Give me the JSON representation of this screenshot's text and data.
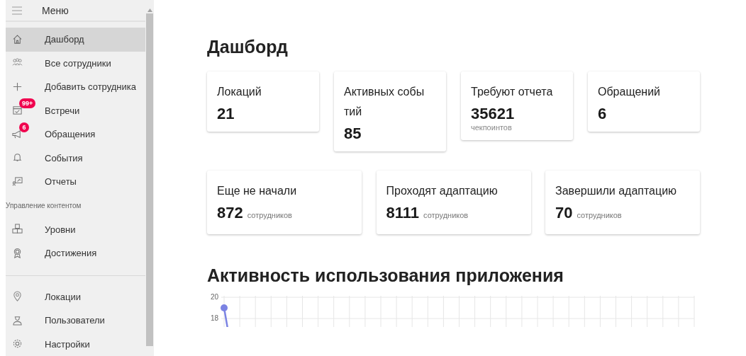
{
  "sidebar": {
    "header": {
      "title": "Меню"
    },
    "items": [
      {
        "kind": "link",
        "label": "Дашборд",
        "selected": true
      },
      {
        "kind": "link",
        "label": "Все сотрудники",
        "selected": false
      },
      {
        "kind": "link",
        "label": "Добавить сотрудника",
        "selected": false
      },
      {
        "kind": "link",
        "label": "Встречи",
        "selected": false,
        "badge": "99+"
      },
      {
        "kind": "link",
        "label": "Обращения",
        "selected": false,
        "badge": "6"
      },
      {
        "kind": "link",
        "label": "События",
        "selected": false
      },
      {
        "kind": "link",
        "label": "Отчеты",
        "selected": false
      },
      {
        "kind": "section",
        "label": "Управление контентом"
      },
      {
        "kind": "link",
        "label": "Уровни",
        "selected": false
      },
      {
        "kind": "link",
        "label": "Достижения",
        "selected": false
      },
      {
        "kind": "divider"
      },
      {
        "kind": "link",
        "label": "Локации",
        "selected": false
      },
      {
        "kind": "link",
        "label": "Пользователи",
        "selected": false
      },
      {
        "kind": "link",
        "label": "Настройки",
        "selected": false
      }
    ]
  },
  "main": {
    "title": "Дашборд",
    "stat_rows": [
      [
        {
          "label": "Локаций",
          "value": "21"
        },
        {
          "label": "Активных собы тий",
          "value": "85"
        },
        {
          "label": "Требуют отчета",
          "value": "35621",
          "caption": "чекпоинтов"
        },
        {
          "label": "Обращений",
          "value": "6"
        }
      ],
      [
        {
          "label": "Еще не начали",
          "value": "872",
          "unit": "сотрудников"
        },
        {
          "label": "Проходят адаптацию",
          "value": "8111",
          "unit": "сотрудников"
        },
        {
          "label": "Завершили адаптацию",
          "value": "70",
          "unit": "сотрудников"
        }
      ]
    ],
    "chart_title": "Активность использования приложения",
    "chart": {
      "y_ticks": [
        "20",
        "18"
      ]
    }
  }
}
